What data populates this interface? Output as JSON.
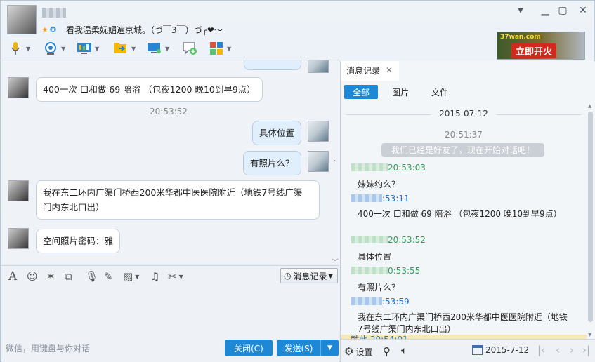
{
  "header": {
    "signature": "看我温柔妩媚遍京城。（づ￣3￣）づ╭❤～",
    "status_icons": [
      "star-icon",
      "qzone-icon"
    ]
  },
  "window_controls": [
    "chevron-down-icon",
    "minimize-icon",
    "maximize-icon",
    "close-icon"
  ],
  "toolbar": {
    "items": [
      "voice-call-icon",
      "video-call-icon",
      "remote-desktop-icon",
      "send-file-icon",
      "screen-share-icon",
      "create-group-icon",
      "apps-icon"
    ]
  },
  "ad": {
    "logo": "37wan.com",
    "button": "立即开火"
  },
  "chat": {
    "top_bubble_fragment": "…",
    "messages": [
      {
        "from": "other",
        "text": "400一次  口和做   69    陪浴   （包夜1200     晚10到早9点）"
      },
      {
        "time": "20:53:52"
      },
      {
        "from": "me",
        "text": "具体位置"
      },
      {
        "from": "me",
        "text": "有照片么？"
      },
      {
        "from": "other",
        "text_line1": "我在东二环内广渠门桥西200米华都中医医院附近（地铁7号线广渠",
        "text_line2": "门内东北口出）"
      },
      {
        "from": "other",
        "text": "空间照片密码：雅"
      }
    ]
  },
  "input_tools": {
    "icons": [
      "font-icon",
      "emoji-icon",
      "shake-icon",
      "screenshot-icon",
      "voice-msg-icon",
      "doodle-icon",
      "image-icon",
      "music-icon",
      "scissors-icon"
    ],
    "history_button": "消息记录"
  },
  "input": {
    "placeholder": "微信，用键盘与你对话",
    "close_button": "关闭(C)",
    "send_button": "发送(S)"
  },
  "history_panel": {
    "tab_label": "消息记录",
    "filters": [
      "全部",
      "图片",
      "文件"
    ],
    "date": "2015-07-12",
    "system_time": "20:51:37",
    "system_message": "我们已经是好友了，现在开始对话吧！",
    "entries": [
      {
        "color": "green",
        "time": "20:53:03",
        "text": "妹妹约么？"
      },
      {
        "color": "blue",
        "time": ":53:11",
        "text": "400一次  口和做   69    陪浴   （包夜1200     晚10到早9点）"
      },
      {
        "color": "green",
        "time": "20:53:52",
        "text": "具体位置"
      },
      {
        "color": "green",
        "time": "0:53:55",
        "text": "有照片么？"
      },
      {
        "color": "blue",
        "time": ":53:59",
        "text": "我在东二环内广渠门桥西200米华都中医医院附近（地铁7号线广渠门内东北口出）"
      }
    ],
    "footer_fragment": "就此  20:54:01",
    "settings_label": "设置",
    "bottom_date": "2015-7-12"
  },
  "colors": {
    "accent": "#1e88d4",
    "green_name": "#2ca05a",
    "blue_name": "#1b6fd0"
  }
}
